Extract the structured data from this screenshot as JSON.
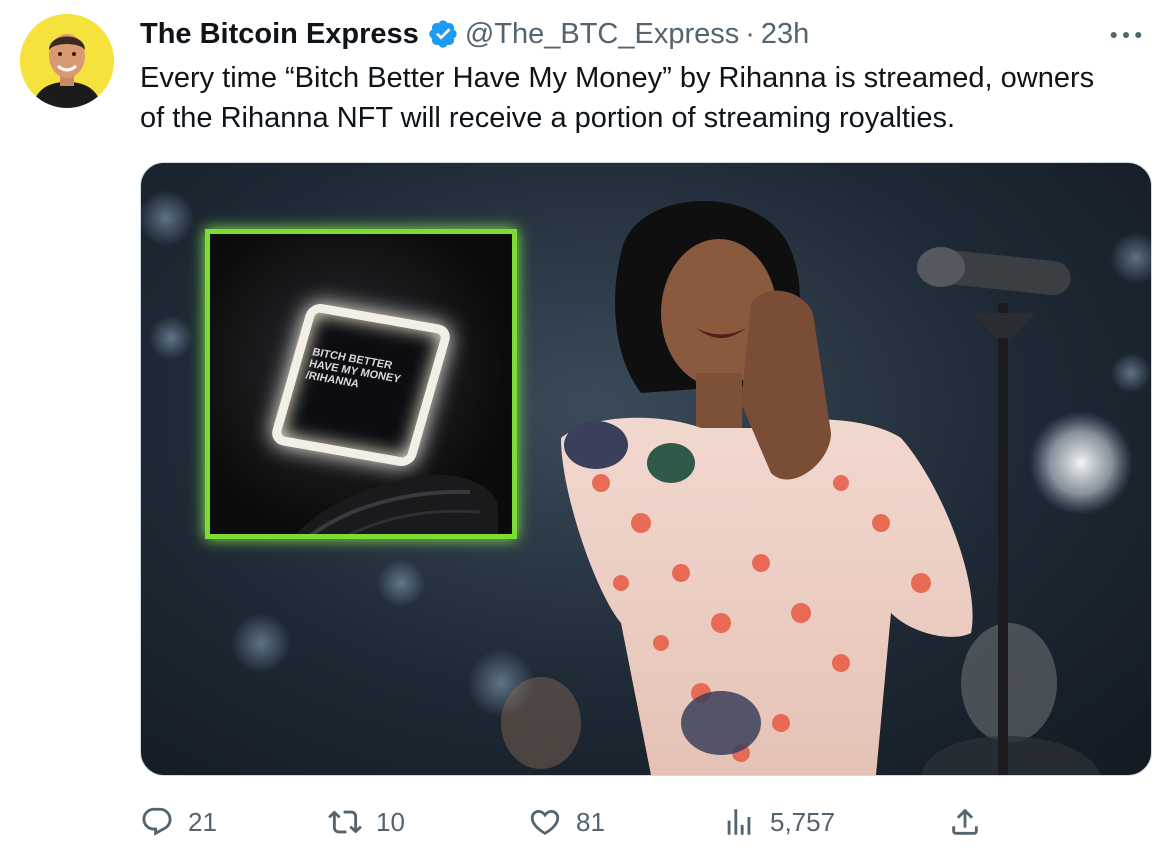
{
  "tweet": {
    "display_name": "The Bitcoin Express",
    "handle": "@The_BTC_Express",
    "separator": "·",
    "time": "23h",
    "verified": true,
    "text_lines": [
      "Every time “Bitch Better Have My Money” by Rihanna is streamed, owners",
      "of the Rihanna NFT will receive a portion of streaming royalties."
    ],
    "media": {
      "nft_card_text": [
        "BITCH BETTER",
        "HAVE MY MONEY",
        "/RIHANNA"
      ],
      "colors": {
        "nft_frame": "#7bdc36",
        "dress": "#e8604a",
        "backdrop": "#1e2935"
      }
    }
  },
  "actions": {
    "replies": "21",
    "retweets": "10",
    "likes": "81",
    "views": "5,757"
  },
  "icons": [
    "verified-badge-icon",
    "more-icon",
    "reply-icon",
    "retweet-icon",
    "like-icon",
    "views-icon",
    "share-icon"
  ],
  "colors": {
    "verified": "#1d9bf0",
    "secondary_text": "#536471",
    "avatar_bg": "#f6e23c"
  }
}
